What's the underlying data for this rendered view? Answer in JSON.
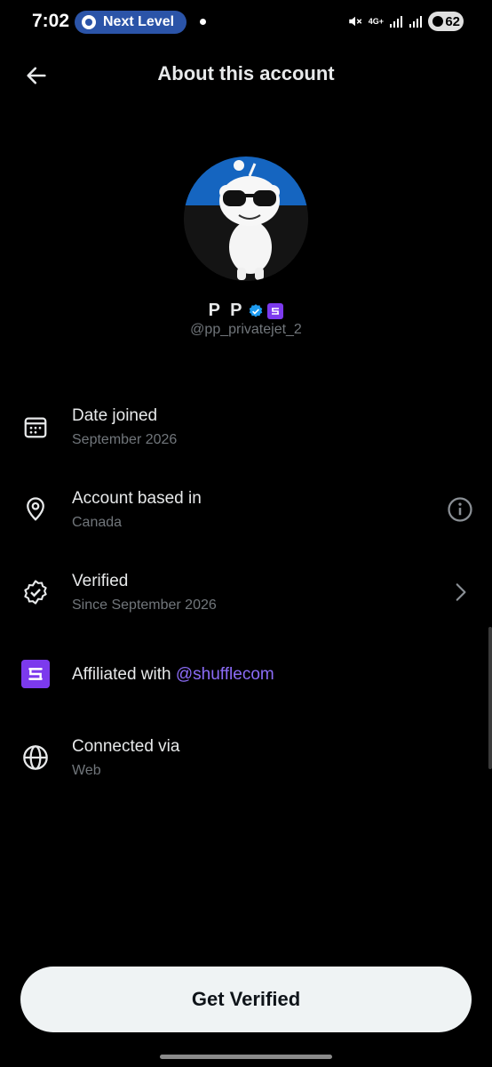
{
  "status_bar": {
    "time": "7:02",
    "pill_text": "Next Level",
    "network": "4G+",
    "battery": "62"
  },
  "header": {
    "title": "About this account",
    "back_icon": "arrow-left-icon"
  },
  "profile": {
    "name": "P P",
    "handle": "@pp_privatejet_2",
    "verified_color": "#1d9bf0",
    "affiliate_badge_color": "#7c3aed"
  },
  "rows": {
    "date_joined": {
      "title": "Date joined",
      "sub": "September 2026",
      "icon": "calendar-icon"
    },
    "based_in": {
      "title": "Account based in",
      "sub": "Canada",
      "icon": "location-pin-icon",
      "trail_icon": "info-icon"
    },
    "verified": {
      "title": "Verified",
      "sub": "Since September 2026",
      "icon": "verified-badge-icon",
      "trail_icon": "chevron-right-icon"
    },
    "affiliated": {
      "prefix": "Affiliated with ",
      "mention": "@shufflecom",
      "icon": "shuffle-logo-icon"
    },
    "connected": {
      "title": "Connected via",
      "sub": "Web",
      "icon": "globe-icon"
    }
  },
  "cta": {
    "label": "Get Verified"
  },
  "colors": {
    "background": "#000000",
    "text_primary": "#e7e9ea",
    "text_secondary": "#71767b",
    "mention": "#8b6cf7",
    "cta_bg": "#eff3f4"
  }
}
